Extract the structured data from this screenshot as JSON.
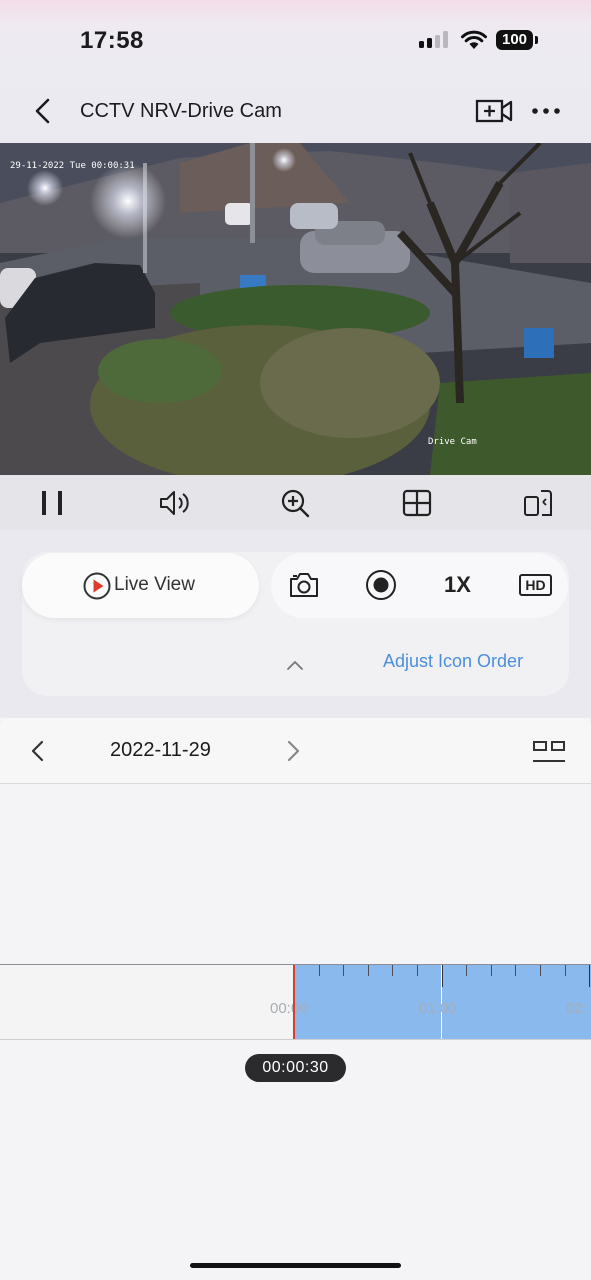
{
  "status_bar": {
    "time": "17:58",
    "battery": "100"
  },
  "header": {
    "title": "CCTV NRV-Drive Cam"
  },
  "video": {
    "timestamp_osd": "29-11-2022 Tue 00:00:31",
    "camera_osd": "Drive Cam"
  },
  "controls": [
    "pause",
    "volume",
    "zoom-in",
    "grid-layout",
    "rotate-screen"
  ],
  "mode_panel": {
    "live_view_label": "Live View",
    "speed_label": "1X",
    "quality_label": "HD",
    "adjust_label": "Adjust Icon Order"
  },
  "date_bar": {
    "date": "2022-11-29"
  },
  "timeline": {
    "labels": [
      "00:00",
      "01:00",
      "02:"
    ],
    "current_time": "00:00:30"
  },
  "colors": {
    "accent": "#4a8fdc",
    "recorded": "#8ab9ee",
    "playhead": "#e03a2f"
  }
}
